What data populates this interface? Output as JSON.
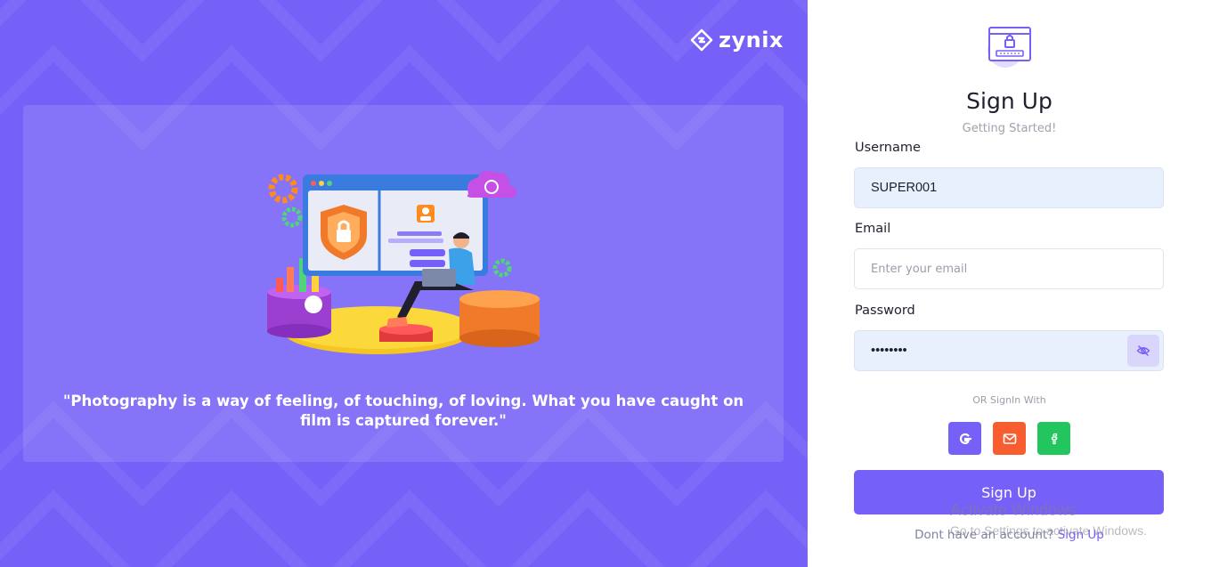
{
  "brand": {
    "name": "zynix"
  },
  "hero": {
    "quote": "\"Photography is a way of feeling, of touching, of loving. What you have caught on film is captured forever.\""
  },
  "form": {
    "title": "Sign Up",
    "subtitle": "Getting Started!",
    "username": {
      "label": "Username",
      "value": "SUPER001"
    },
    "email": {
      "label": "Email",
      "placeholder": "Enter your email"
    },
    "password": {
      "label": "Password",
      "value": "••••••••"
    },
    "or_text": "OR SignIn With",
    "submit_label": "Sign Up",
    "footer_text": "Dont have an account?",
    "footer_link": "Sign Up"
  },
  "social": [
    {
      "name": "google-icon",
      "color": "#7560f8"
    },
    {
      "name": "mail-icon",
      "color": "#f85d2f"
    },
    {
      "name": "facebook-icon",
      "color": "#22c55e"
    }
  ],
  "watermark": {
    "line1": "Activate Windows",
    "line2": "Go to Settings to activate Windows."
  },
  "colors": {
    "primary": "#7560f8",
    "mail": "#f85d2f",
    "facebook": "#22c55e",
    "input_filled": "#e8f0fe"
  }
}
